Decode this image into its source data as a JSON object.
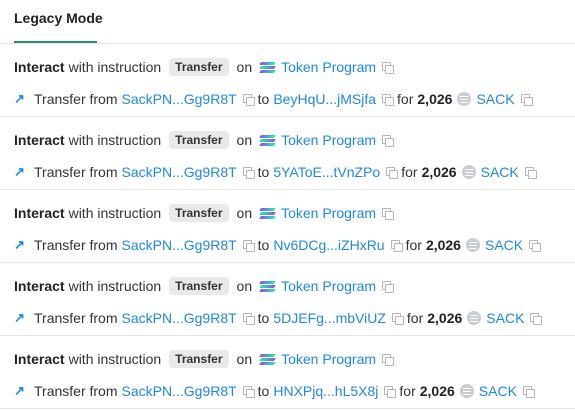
{
  "tab": {
    "label": "Legacy Mode"
  },
  "instructions": [
    {
      "interact_label": "Interact",
      "with_text": "with instruction",
      "badge": "Transfer",
      "on_text": "on",
      "program": "Token Program",
      "transfer_text": "Transfer from",
      "from": "SackPN...Gg9R8T",
      "to_text": "to",
      "to": "BeyHqU...jMSjfa",
      "for_text": "for",
      "amount": "2,026",
      "token": "SACK"
    },
    {
      "interact_label": "Interact",
      "with_text": "with instruction",
      "badge": "Transfer",
      "on_text": "on",
      "program": "Token Program",
      "transfer_text": "Transfer from",
      "from": "SackPN...Gg9R8T",
      "to_text": "to",
      "to": "5YAToE...tVnZPo",
      "for_text": "for",
      "amount": "2,026",
      "token": "SACK"
    },
    {
      "interact_label": "Interact",
      "with_text": "with instruction",
      "badge": "Transfer",
      "on_text": "on",
      "program": "Token Program",
      "transfer_text": "Transfer from",
      "from": "SackPN...Gg9R8T",
      "to_text": "to",
      "to": "Nv6DCg...iZHxRu",
      "for_text": "for",
      "amount": "2,026",
      "token": "SACK"
    },
    {
      "interact_label": "Interact",
      "with_text": "with instruction",
      "badge": "Transfer",
      "on_text": "on",
      "program": "Token Program",
      "transfer_text": "Transfer from",
      "from": "SackPN...Gg9R8T",
      "to_text": "to",
      "to": "5DJEFg...mbViUZ",
      "for_text": "for",
      "amount": "2,026",
      "token": "SACK"
    },
    {
      "interact_label": "Interact",
      "with_text": "with instruction",
      "badge": "Transfer",
      "on_text": "on",
      "program": "Token Program",
      "transfer_text": "Transfer from",
      "from": "SackPN...Gg9R8T",
      "to_text": "to",
      "to": "HNXPjq...hL5X8j",
      "for_text": "for",
      "amount": "2,026",
      "token": "SACK"
    }
  ],
  "icons": {
    "program": "solana-icon",
    "copy": "copy-icon",
    "transfer": "arrow-up-right-icon",
    "token": "token-icon"
  },
  "colors": {
    "link": "#1e88e5",
    "tab_underline": "#2a8a77",
    "badge_bg": "#e9e9e9"
  }
}
